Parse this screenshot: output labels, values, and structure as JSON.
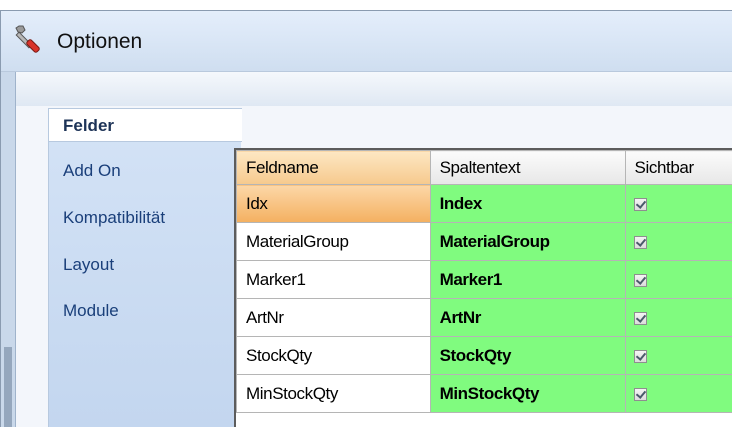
{
  "window": {
    "title": "Optionen",
    "icon": "wrench-screwdriver-icon"
  },
  "nav": {
    "items": [
      {
        "label": "Felder",
        "active": true
      },
      {
        "label": "Add On"
      },
      {
        "label": "Kompatibilität"
      },
      {
        "label": "Layout"
      },
      {
        "label": "Module"
      }
    ]
  },
  "grid": {
    "columns": [
      "Feldname",
      "Spaltentext",
      "Sichtbar"
    ],
    "rows": [
      {
        "feldname": "Idx",
        "spaltentext": "Index",
        "sichtbar": true
      },
      {
        "feldname": "MaterialGroup",
        "spaltentext": "MaterialGroup",
        "sichtbar": true
      },
      {
        "feldname": "Marker1",
        "spaltentext": "Marker1",
        "sichtbar": true
      },
      {
        "feldname": "ArtNr",
        "spaltentext": "ArtNr",
        "sichtbar": true
      },
      {
        "feldname": "StockQty",
        "spaltentext": "StockQty",
        "sichtbar": true
      },
      {
        "feldname": "MinStockQty",
        "spaltentext": "MinStockQty",
        "sichtbar": true
      }
    ]
  },
  "colors": {
    "highlight_green": "#80fb7f",
    "selection_orange": "#f4b060"
  }
}
